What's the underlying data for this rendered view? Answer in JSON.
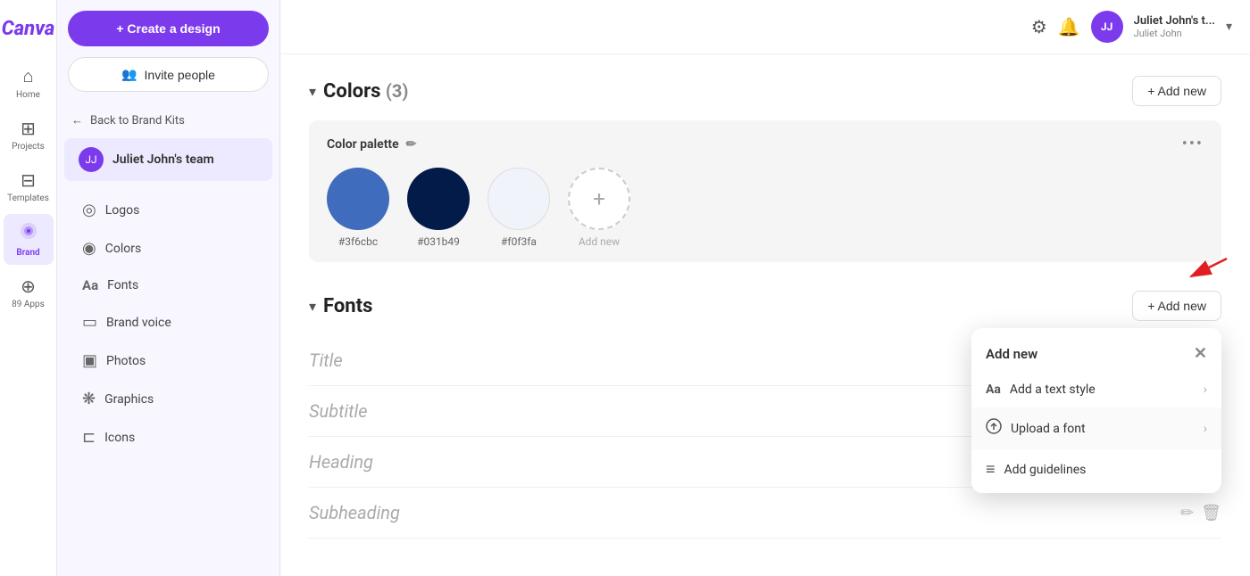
{
  "app": {
    "logo": "Canva"
  },
  "icon_nav": {
    "items": [
      {
        "id": "home",
        "label": "Home",
        "icon": "⌂"
      },
      {
        "id": "projects",
        "label": "Projects",
        "icon": "⊞"
      },
      {
        "id": "templates",
        "label": "Templates",
        "icon": "⊟"
      },
      {
        "id": "brand",
        "label": "Brand",
        "icon": "◈",
        "active": true
      },
      {
        "id": "apps",
        "label": "89 Apps",
        "icon": "⊕"
      }
    ]
  },
  "sidebar": {
    "create_button": "+ Create a design",
    "invite_button": "Invite people",
    "back_link": "Back to Brand Kits",
    "team_name": "Juliet John's team",
    "nav_items": [
      {
        "id": "logos",
        "label": "Logos",
        "icon": "◎"
      },
      {
        "id": "colors",
        "label": "Colors",
        "icon": "◎"
      },
      {
        "id": "fonts",
        "label": "Fonts",
        "icon": "Aa"
      },
      {
        "id": "brand_voice",
        "label": "Brand voice",
        "icon": "▭"
      },
      {
        "id": "photos",
        "label": "Photos",
        "icon": "▣"
      },
      {
        "id": "graphics",
        "label": "Graphics",
        "icon": "❋"
      },
      {
        "id": "icons",
        "label": "Icons",
        "icon": "⊏"
      }
    ]
  },
  "topbar": {
    "settings_icon": "⚙",
    "bell_icon": "🔔",
    "user_initials": "JJ",
    "user_name": "Juliet John's t...",
    "user_sub": "Juliet John"
  },
  "colors_section": {
    "title": "Colors",
    "count": "(3)",
    "add_new_label": "+ Add new",
    "palette": {
      "name": "Color palette",
      "edit_icon": "✏",
      "menu": "...",
      "swatches": [
        {
          "id": "swatch1",
          "color": "#3f6cbc",
          "label": "#3f6cbc"
        },
        {
          "id": "swatch2",
          "color": "#031b49",
          "label": "#031b49"
        },
        {
          "id": "swatch3",
          "color": "#f0f3fa",
          "label": "#f0f3fa"
        }
      ],
      "add_swatch_label": "Add new"
    }
  },
  "fonts_section": {
    "title": "Fonts",
    "add_new_label": "+ Add new",
    "rows": [
      {
        "id": "title",
        "label": "Title"
      },
      {
        "id": "subtitle",
        "label": "Subtitle"
      },
      {
        "id": "heading",
        "label": "Heading"
      },
      {
        "id": "subheading",
        "label": "Subheading"
      }
    ]
  },
  "add_new_dropdown": {
    "title": "Add new",
    "close_icon": "✕",
    "items": [
      {
        "id": "text_style",
        "icon": "Aa",
        "label": "Add a text style",
        "has_chevron": true
      },
      {
        "id": "upload_font",
        "icon": "↑",
        "label": "Upload a font",
        "has_chevron": true
      },
      {
        "id": "guidelines",
        "icon": "≡",
        "label": "Add guidelines",
        "has_chevron": false
      }
    ]
  }
}
